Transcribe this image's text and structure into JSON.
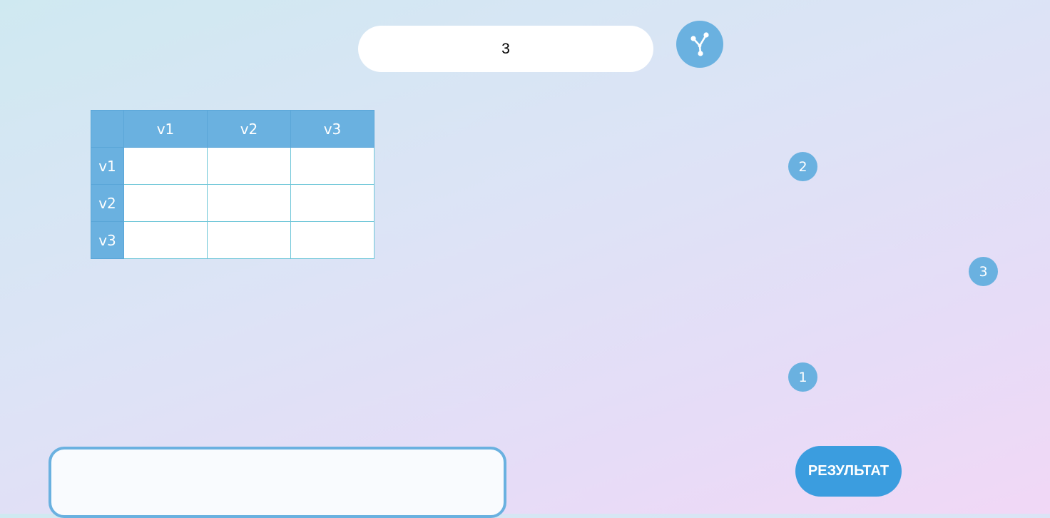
{
  "vertex_count": {
    "value": "3"
  },
  "graph_button": {
    "icon": "graph-nodes-icon"
  },
  "matrix": {
    "corner": "",
    "columns": [
      "v1",
      "v2",
      "v3"
    ],
    "rows": [
      {
        "label": "v1",
        "cells": [
          "",
          "",
          ""
        ]
      },
      {
        "label": "v2",
        "cells": [
          "",
          "",
          ""
        ]
      },
      {
        "label": "v3",
        "cells": [
          "",
          "",
          ""
        ]
      }
    ]
  },
  "graph_nodes": [
    {
      "label": "2"
    },
    {
      "label": "3"
    },
    {
      "label": "1"
    }
  ],
  "result": {
    "output": "",
    "button_label": "РЕЗУЛЬТАТ"
  },
  "colors": {
    "accent": "#6ab1e0",
    "button": "#3b9ddf",
    "cell_border": "#6ec6d8"
  }
}
